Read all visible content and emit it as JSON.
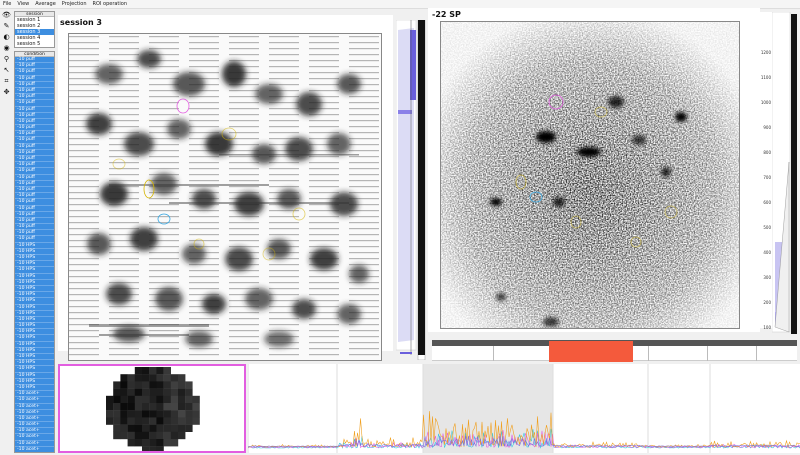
{
  "menu": [
    "File",
    "View",
    "Average",
    "Projection",
    "ROI operation"
  ],
  "tools": [
    {
      "name": "eye-icon",
      "glyph": "👁"
    },
    {
      "name": "pointer-roi-icon",
      "glyph": "✎"
    },
    {
      "name": "contrast-icon",
      "glyph": "◐"
    },
    {
      "name": "visibility-icon",
      "glyph": "◉"
    },
    {
      "name": "zoom-icon",
      "glyph": "⚲"
    },
    {
      "name": "cursor-icon",
      "glyph": "↖"
    },
    {
      "name": "crop-icon",
      "glyph": "⌗"
    },
    {
      "name": "move-icon",
      "glyph": "✥"
    }
  ],
  "sessions": {
    "header": "session",
    "items": [
      "session 1",
      "session 2",
      "session 3",
      "session 4",
      "session 5"
    ],
    "selected_index": 2
  },
  "conditions": {
    "header": "condition",
    "items": [
      "-10 puff",
      "-10 puff",
      "-10 puff",
      "-10 puff",
      "-10 puff",
      "-10 puff",
      "-10 puff",
      "-10 puff",
      "-10 puff",
      "-10 puff",
      "-10 puff",
      "-10 puff",
      "-10 puff",
      "-10 puff",
      "-10 puff",
      "-10 puff",
      "-10 puff",
      "-10 puff",
      "-10 puff",
      "-10 puff",
      "-10 puff",
      "-10 puff",
      "-10 puff",
      "-10 puff",
      "-10 puff",
      "-10 puff",
      "-10 puff",
      "-10 puff",
      "-10 puff",
      "-10 puff",
      "-10 HPS",
      "-10 HPS",
      "-10 HPS",
      "-10 HPS",
      "-10 HPS",
      "-10 HPS",
      "-10 HPS",
      "-10 HPS",
      "-10 HPS",
      "-10 HPS",
      "-10 HPS",
      "-10 HPS",
      "-10 HPS",
      "-10 HPS",
      "-10 HPS",
      "-10 HPS",
      "-10 HPS",
      "-10 HPS",
      "-10 HPS",
      "-10 HPS",
      "-10 HPS",
      "-10 HPS",
      "-10 HPS",
      "-10 HPS",
      "-10 acet+",
      "-10 acet+",
      "-10 acet+",
      "-10 acet+",
      "-10 acet+",
      "-10 acet+",
      "-10 acet+",
      "-10 acet+",
      "-10 acet+",
      "-10 acet+"
    ]
  },
  "left_panel": {
    "title": "session 3"
  },
  "right_panel": {
    "title": "-22 SP",
    "yticks": [
      "1200",
      "1100",
      "1000",
      "900",
      "800",
      "700",
      "600",
      "500",
      "400",
      "300",
      "200",
      "100"
    ]
  },
  "colors": {
    "selection": "#3d8ee0",
    "roi_highlight": "#e25ee0",
    "time_window": "#f45a3c",
    "colorbar": "#7b6fe0"
  }
}
